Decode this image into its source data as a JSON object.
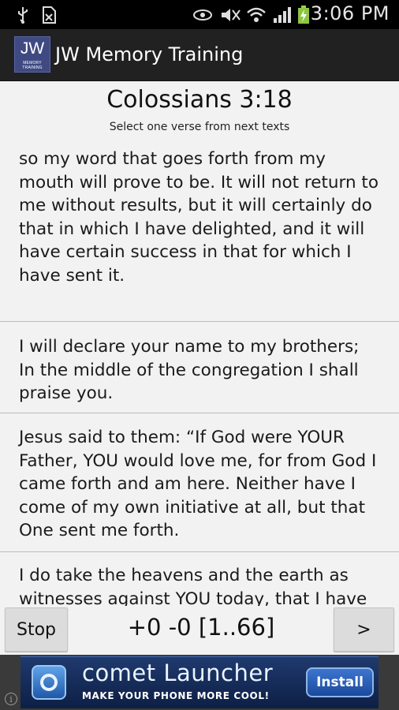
{
  "status_bar": {
    "time": "3:06 PM",
    "icons": [
      "usb-icon",
      "sd-card-icon",
      "eye-icon",
      "mute-icon",
      "wifi-icon",
      "signal-icon",
      "battery-charging-icon"
    ]
  },
  "app": {
    "title": "JW Memory Training",
    "logo_text": "JW",
    "logo_subtext": "MEMORY TRAINING"
  },
  "question": {
    "reference": "Colossians 3:18",
    "instruction": "Select one verse from next texts"
  },
  "options": [
    {
      "text": "so my word that goes forth from my mouth will prove to be. It will not return to me without results, but it will certainly do that in which I have delighted, and it will have certain success in that for which I have sent it."
    },
    {
      "text": "I will declare your name to my brothers; In the middle of the congregation I shall praise you."
    },
    {
      "text": " Jesus said to them: “If God were YOUR Father, YOU would love me, for from God I came forth and am here. Neither have I come of my own initiative at all, but that One sent me forth."
    },
    {
      "text": "I do take the heavens and the earth as witnesses against YOU today, that I have"
    }
  ],
  "controls": {
    "stop_label": "Stop",
    "score": "+0 -0 [1..66]",
    "next_label": ">"
  },
  "ad": {
    "title": "comet Launcher",
    "tagline": "MAKE YOUR PHONE MORE COOL!",
    "install_label": "Install",
    "info_label": "i"
  },
  "colors": {
    "status_bar_bg": "#000000",
    "action_bar_bg": "#212121",
    "content_bg": "#f2f2f2",
    "logo_bg": "#3f4a82",
    "ad_bg": "#1f3a6e"
  }
}
